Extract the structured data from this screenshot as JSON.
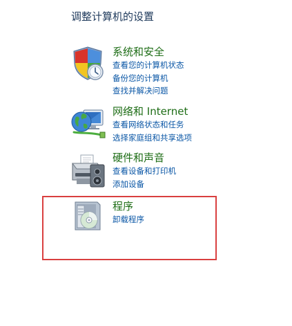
{
  "page": {
    "title": "调整计算机的设置"
  },
  "categories": [
    {
      "title": "系统和安全",
      "icon": "shield-icon",
      "links": [
        "查看您的计算机状态",
        "备份您的计算机",
        "查找并解决问题"
      ]
    },
    {
      "title": "网络和 Internet",
      "icon": "network-globe-icon",
      "links": [
        "查看网络状态和任务",
        "选择家庭组和共享选项"
      ]
    },
    {
      "title": "硬件和声音",
      "icon": "printer-speaker-icon",
      "links": [
        "查看设备和打印机",
        "添加设备"
      ]
    },
    {
      "title": "程序",
      "icon": "programs-disc-icon",
      "links": [
        "卸载程序"
      ]
    }
  ],
  "highlight": {
    "color": "#d93f3f"
  },
  "colors": {
    "category_title": "#1e6d16",
    "link": "#0b57a6",
    "heading": "#1e395b"
  }
}
